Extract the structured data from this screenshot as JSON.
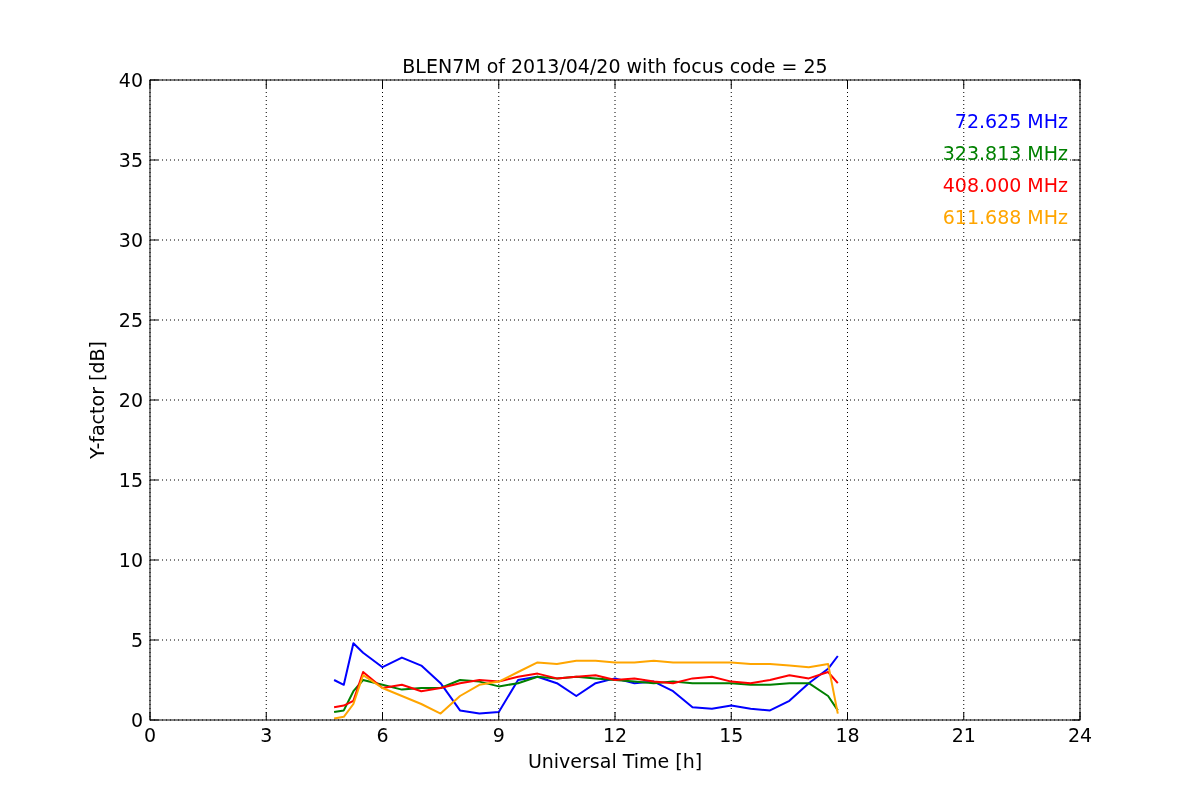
{
  "chart_data": {
    "type": "line",
    "title": "BLEN7M of 2013/04/20 with focus code = 25",
    "xlabel": "Universal Time [h]",
    "ylabel": "Y-factor [dB]",
    "xlim": [
      0,
      24
    ],
    "ylim": [
      0,
      40
    ],
    "grid": true,
    "xticks": [
      0,
      3,
      6,
      9,
      12,
      15,
      18,
      21,
      24
    ],
    "yticks": [
      0,
      5,
      10,
      15,
      20,
      25,
      30,
      35,
      40
    ],
    "x": [
      4.75,
      5,
      5.25,
      5.5,
      6,
      6.5,
      7,
      7.5,
      8,
      8.5,
      9,
      9.5,
      10,
      10.5,
      11,
      11.5,
      12,
      12.5,
      13,
      13.5,
      14,
      14.5,
      15,
      15.5,
      16,
      16.5,
      17,
      17.5,
      17.75
    ],
    "series": [
      {
        "name": "72.625 MHz",
        "color": "#0000ff",
        "values": [
          2.5,
          2.2,
          4.8,
          4.2,
          3.3,
          3.9,
          3.4,
          2.3,
          0.6,
          0.4,
          0.5,
          2.5,
          2.7,
          2.3,
          1.5,
          2.3,
          2.6,
          2.3,
          2.4,
          1.8,
          0.8,
          0.7,
          0.9,
          0.7,
          0.6,
          1.2,
          2.3,
          3.2,
          4.0
        ]
      },
      {
        "name": "323.813 MHz",
        "color": "#008000",
        "values": [
          0.5,
          0.6,
          1.8,
          2.5,
          2.2,
          1.9,
          2.0,
          2.0,
          2.5,
          2.4,
          2.1,
          2.3,
          2.7,
          2.6,
          2.7,
          2.6,
          2.5,
          2.4,
          2.3,
          2.4,
          2.3,
          2.3,
          2.3,
          2.2,
          2.2,
          2.3,
          2.3,
          1.5,
          0.6
        ]
      },
      {
        "name": "408.000 MHz",
        "color": "#ff0000",
        "values": [
          0.8,
          0.9,
          1.2,
          3.0,
          2.0,
          2.2,
          1.8,
          2.0,
          2.3,
          2.5,
          2.4,
          2.7,
          2.9,
          2.6,
          2.7,
          2.8,
          2.5,
          2.6,
          2.4,
          2.3,
          2.6,
          2.7,
          2.4,
          2.3,
          2.5,
          2.8,
          2.6,
          3.0,
          2.3
        ]
      },
      {
        "name": "611.688 MHz",
        "color": "#ffa500",
        "values": [
          0.1,
          0.2,
          1.0,
          2.8,
          2.0,
          1.5,
          1.0,
          0.4,
          1.5,
          2.2,
          2.4,
          3.0,
          3.6,
          3.5,
          3.7,
          3.7,
          3.6,
          3.6,
          3.7,
          3.6,
          3.6,
          3.6,
          3.6,
          3.5,
          3.5,
          3.4,
          3.3,
          3.5,
          0.4
        ]
      }
    ]
  }
}
